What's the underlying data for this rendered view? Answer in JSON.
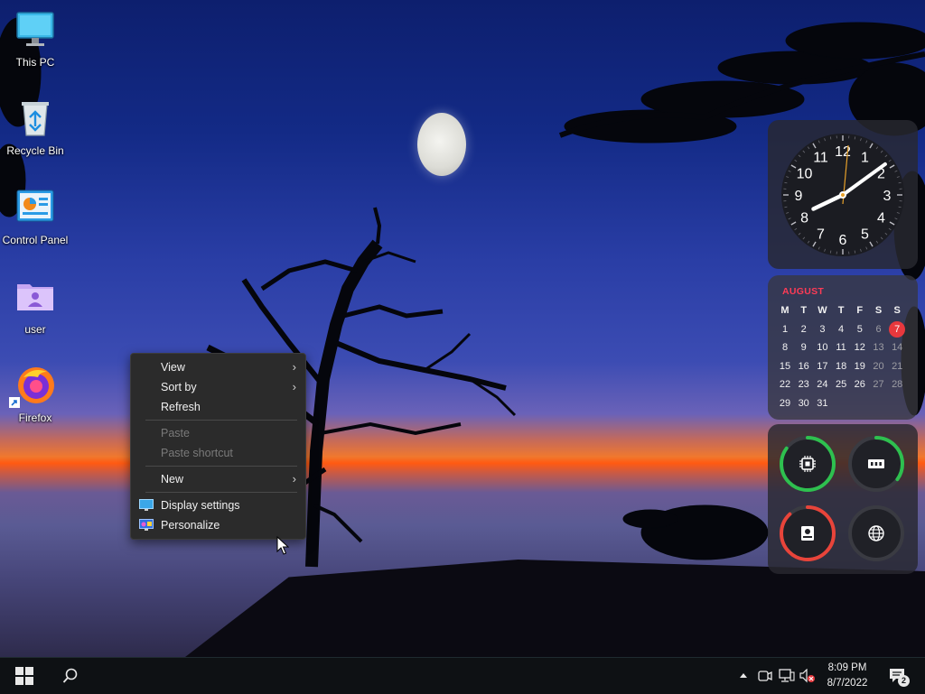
{
  "desktop_icons": [
    {
      "label": "This PC",
      "icon": "monitor-icon"
    },
    {
      "label": "Recycle Bin",
      "icon": "recycle-bin-icon"
    },
    {
      "label": "Control Panel",
      "icon": "control-panel-icon"
    },
    {
      "label": "user",
      "icon": "user-folder-icon"
    },
    {
      "label": "Firefox",
      "icon": "firefox-icon"
    }
  ],
  "context_menu": {
    "items": [
      {
        "label": "View",
        "submenu": true,
        "enabled": true
      },
      {
        "label": "Sort by",
        "submenu": true,
        "enabled": true
      },
      {
        "label": "Refresh",
        "submenu": false,
        "enabled": true
      },
      {
        "label": "Paste",
        "submenu": false,
        "enabled": false
      },
      {
        "label": "Paste shortcut",
        "submenu": false,
        "enabled": false
      },
      {
        "label": "New",
        "submenu": true,
        "enabled": true
      },
      {
        "label": "Display settings",
        "submenu": false,
        "enabled": true,
        "icon": "display-settings-icon"
      },
      {
        "label": "Personalize",
        "submenu": false,
        "enabled": true,
        "icon": "personalize-icon"
      }
    ],
    "chevron_glyph": "›"
  },
  "clock_widget": {
    "numbers": [
      "12",
      "1",
      "2",
      "3",
      "4",
      "5",
      "6",
      "7",
      "8",
      "9",
      "10",
      "11"
    ],
    "hour": 8,
    "minute": 9
  },
  "calendar_widget": {
    "month": "AUGUST",
    "weekdays": [
      "M",
      "T",
      "W",
      "T",
      "F",
      "S",
      "S"
    ],
    "weeks": [
      [
        "1",
        "2",
        "3",
        "4",
        "5",
        "6",
        "7"
      ],
      [
        "8",
        "9",
        "10",
        "11",
        "12",
        "13",
        "14"
      ],
      [
        "15",
        "16",
        "17",
        "18",
        "19",
        "20",
        "21"
      ],
      [
        "22",
        "23",
        "24",
        "25",
        "26",
        "27",
        "28"
      ],
      [
        "29",
        "30",
        "31",
        "",
        "",
        "",
        ""
      ]
    ],
    "today": "7",
    "today_color": "#e8383d",
    "month_color": "#ff3b56"
  },
  "system_monitor_widget": {
    "gauges": [
      {
        "name": "cpu",
        "icon": "cpu-chip-icon",
        "level": 0.85,
        "color": "#2ec04f"
      },
      {
        "name": "memory",
        "icon": "memory-ram-icon",
        "level": 0.35,
        "color": "#2ec04f"
      },
      {
        "name": "disk",
        "icon": "hard-disk-icon",
        "level": 0.88,
        "color": "#e8443a"
      },
      {
        "name": "network",
        "icon": "globe-icon",
        "level": 0.0,
        "color": "#2ec04f"
      }
    ]
  },
  "taskbar": {
    "start_icon": "windows-start-icon",
    "search_icon": "search-icon",
    "tray": {
      "icons": [
        "chevron-up-icon",
        "camera-icon",
        "network-icon",
        "volume-muted-icon"
      ],
      "time": "8:09 PM",
      "date": "8/7/2022",
      "notification_count": "2"
    }
  },
  "colors": {
    "menu_bg": "#2b2b2b",
    "taskbar_bg": "#0e1114",
    "accent_red": "#e8383d",
    "accent_green": "#2ec04f"
  }
}
